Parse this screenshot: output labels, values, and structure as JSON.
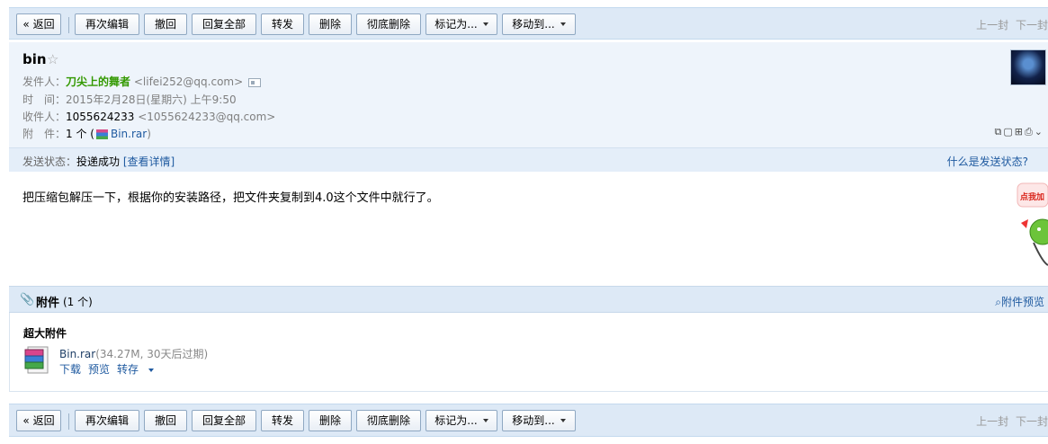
{
  "toolbar": {
    "back": "« 返回",
    "resend": "再次编辑",
    "recall": "撤回",
    "reply_all": "回复全部",
    "forward": "转发",
    "delete": "删除",
    "delete_permanently": "彻底删除",
    "mark_as": "标记为...",
    "move_to": "移动到...",
    "prev": "上一封",
    "next": "下一封"
  },
  "header": {
    "subject": "bin",
    "from_label": "发件人：",
    "from_name": "刀尖上的舞者",
    "from_email": "<lifei252@qq.com>",
    "time_label": "时　间：",
    "time_value": "2015年2月28日(星期六) 上午9:50",
    "to_label": "收件人：",
    "to_name": "1055624233",
    "to_email": "<1055624233@qq.com>",
    "attach_label": "附　件：",
    "attach_count": "1 个 (",
    "attach_file": "Bin.rar",
    "attach_close": ")"
  },
  "status": {
    "label": "发送状态：",
    "value": "投递成功",
    "detail": "[查看详情]",
    "help": "什么是发送状态?"
  },
  "body": {
    "text": "把压缩包解压一下，根据你的安装路径，把文件夹复制到4.0这个文件中就行了。",
    "mascot_text": "点我加"
  },
  "attachments": {
    "title": "附件",
    "count": "(1 个)",
    "preview_all": "附件预览",
    "section_label": "超大附件",
    "file_name": "Bin.rar",
    "file_meta": "(34.27M, 30天后过期)",
    "download": "下载",
    "preview": "预览",
    "save": "转存"
  },
  "colors": {
    "toolbar_bg": "#dde9f6",
    "header_bg": "#eef4fb",
    "sender_green": "#339900",
    "link_blue": "#1f5aa0"
  }
}
